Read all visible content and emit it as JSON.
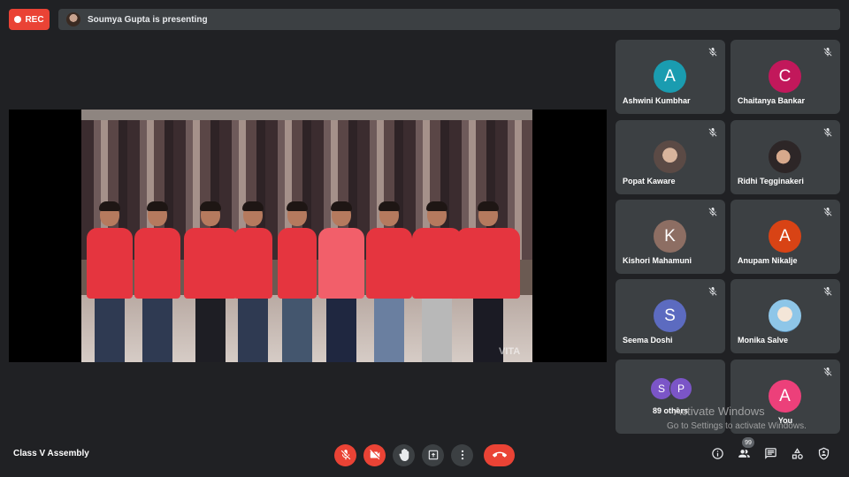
{
  "recording": {
    "label": "REC"
  },
  "presenter_bar": {
    "text": "Soumya Gupta is presenting"
  },
  "participants": [
    {
      "name": "Ashwini Kumbhar",
      "initial": "A",
      "color": "#1a9cb0",
      "muted": true
    },
    {
      "name": "Chaitanya Bankar",
      "initial": "C",
      "color": "#c2185b",
      "muted": true
    },
    {
      "name": "Popat Kaware",
      "initial": "",
      "color": "",
      "muted": true
    },
    {
      "name": "Ridhi Tegginakeri",
      "initial": "",
      "color": "",
      "muted": true
    },
    {
      "name": "Kishori Mahamuni",
      "initial": "K",
      "color": "#8d6e63",
      "muted": true
    },
    {
      "name": "Anupam Nikalje",
      "initial": "A",
      "color": "#d84315",
      "muted": true
    },
    {
      "name": "Seema Doshi",
      "initial": "S",
      "color": "#5c6bc0",
      "muted": true
    },
    {
      "name": "Monika Salve",
      "initial": "",
      "color": "",
      "muted": true
    }
  ],
  "others_tile": {
    "initials": [
      "S",
      "P"
    ],
    "label": "89 others"
  },
  "self_tile": {
    "initial": "A",
    "name": "You",
    "color": "#ec407a",
    "muted": true
  },
  "video_watermark": "VITA",
  "activation_notice": {
    "line1": "Activate Windows",
    "line2": "Go to Settings to activate Windows."
  },
  "meeting": {
    "title": "Class V Assembly"
  },
  "people_count": "99",
  "colors": {
    "accent_red": "#ea4335",
    "tile_bg": "#3c4043",
    "background": "#202124"
  },
  "icons": [
    "mic-off-icon",
    "camera-off-icon",
    "raise-hand-icon",
    "present-icon",
    "more-options-icon",
    "end-call-icon",
    "info-icon",
    "people-icon",
    "chat-icon",
    "activities-icon",
    "host-controls-icon"
  ]
}
